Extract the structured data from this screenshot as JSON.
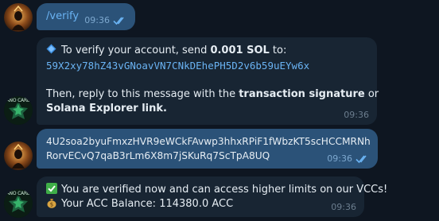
{
  "colors": {
    "background": "#0e1621",
    "outgoing_bubble": "#2b5278",
    "incoming_bubble": "#182533",
    "link": "#6ab3f3"
  },
  "messages": [
    {
      "direction": "outgoing",
      "text": "/verify",
      "time": "09:36",
      "status": "read"
    },
    {
      "direction": "incoming",
      "icon": "blue-diamond-icon",
      "line1_prefix": "To verify your account, send ",
      "line1_amount": "0.001 SOL",
      "line1_suffix": " to:",
      "address": "59X2xy78hZ43vGNoavVN7CNkDEhePH5D2v6b59uEYw6x",
      "line3_prefix": "Then, reply to this message with the ",
      "line3_bold": "transaction signature",
      "line3_suffix": " or",
      "line4_bold": "Solana Explorer link.",
      "time": "09:36"
    },
    {
      "direction": "outgoing",
      "line1": "4U2soa2byuFmxzHVR9eWCkFAvwp3hhxRPiF1fWbzKT5scHCCMRNh",
      "line2": "RorvECvQ7qaB3rLm6X8m7jSKuRq7ScTpA8UQ",
      "time": "09:36",
      "status": "read"
    },
    {
      "direction": "incoming",
      "line1_icon": "check-mark-icon",
      "line1": "You are verified now and can access higher limits on our VCCs!",
      "line2_icon": "money-bag-icon",
      "line2": "Your ACC Balance: 114380.0 ACC",
      "time": "09:36"
    }
  ],
  "avatars": {
    "user_icon": "user-avatar-icon",
    "bot_label": "ANO CARD"
  }
}
